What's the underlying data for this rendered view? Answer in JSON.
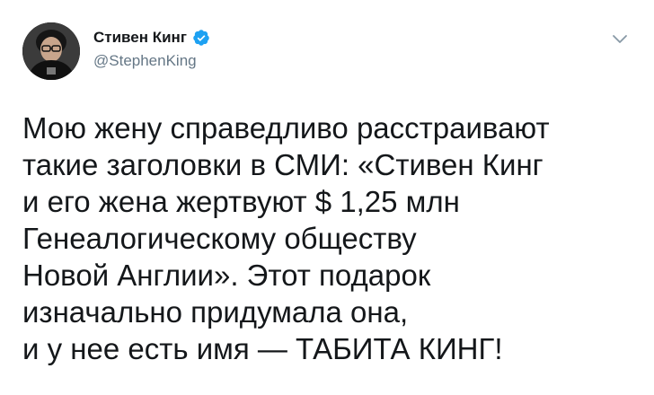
{
  "author": {
    "display_name": "Стивен Кинг",
    "handle": "@StephenKing",
    "verified": true,
    "verified_color": "#1da1f2",
    "avatar_icon": "avatar-portrait"
  },
  "menu": {
    "icon": "chevron-down-icon"
  },
  "tweet": {
    "lines": [
      "Мою жену справедливо расстраивают",
      "такие заголовки в СМИ: «Стивен Кинг",
      "и его жена жертвуют $ 1,25 млн",
      "Генеалогическому обществу",
      "Новой Англии». Этот подарок",
      "изначально придумала она,",
      "и у нее есть имя — ТАБИТА КИНГ!"
    ]
  }
}
